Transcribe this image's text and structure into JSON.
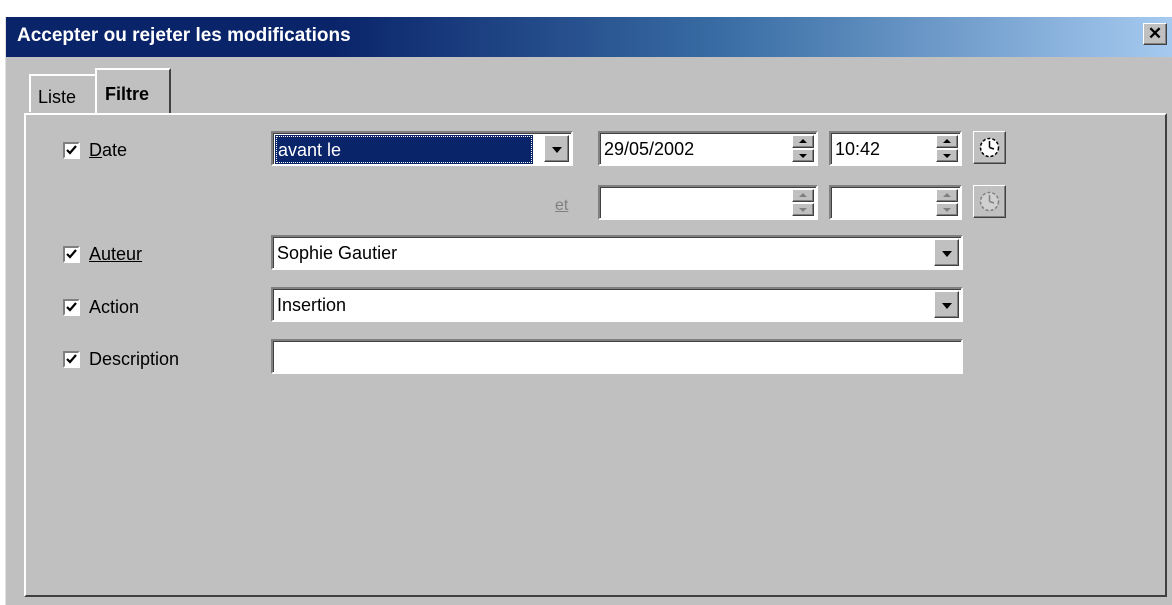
{
  "window": {
    "title": "Accepter ou rejeter les modifications",
    "close_glyph": "✕"
  },
  "tabs": [
    {
      "label": "Liste",
      "active": false
    },
    {
      "label": "Filtre",
      "active": true
    }
  ],
  "filter": {
    "date": {
      "checked": true,
      "label": "Date",
      "mnemonic": "D",
      "condition": "avant le",
      "date_value": "29/05/2002",
      "time_value": "10:42",
      "and_label": "et",
      "date2_value": "",
      "time2_value": ""
    },
    "author": {
      "checked": true,
      "label": "Auteur",
      "value": "Sophie Gautier"
    },
    "action": {
      "checked": true,
      "label": "Action",
      "value": "Insertion"
    },
    "description": {
      "checked": true,
      "label": "Description",
      "value": ""
    }
  },
  "icons": {
    "clock": "clock-icon",
    "checkmark": "checkmark-icon",
    "dropdown": "chevron-down-icon"
  },
  "colors": {
    "title_start": "#0a246a",
    "title_end": "#a6caf0",
    "face": "#c0c0c0",
    "selection": "#0a246a"
  }
}
